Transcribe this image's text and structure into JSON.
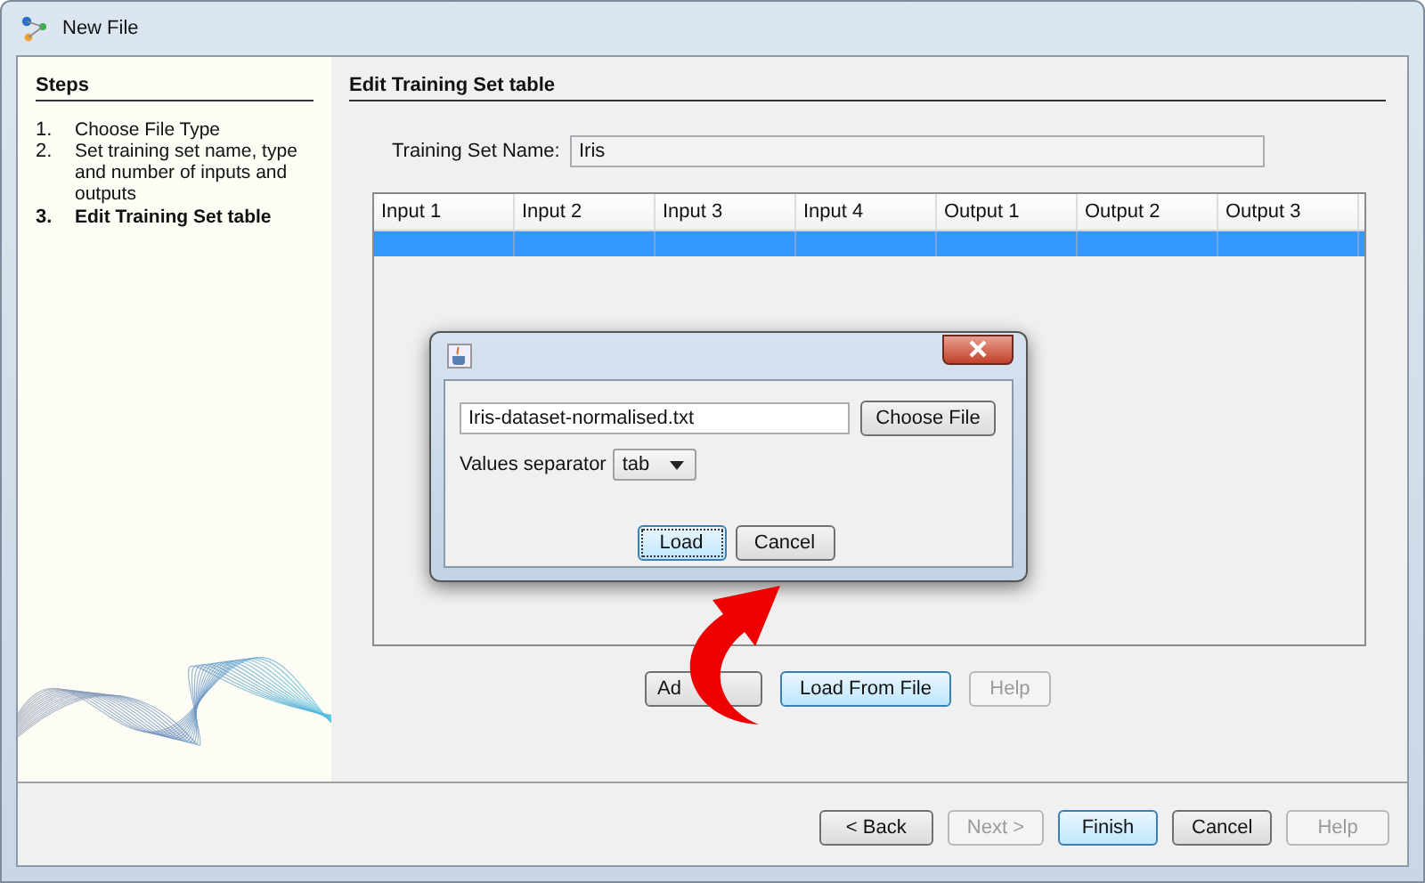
{
  "window": {
    "title": "New File"
  },
  "steps": {
    "title": "Steps",
    "items": [
      {
        "number": "1.",
        "text": "Choose File Type",
        "selected": false
      },
      {
        "number": "2.",
        "text": "Set training set name, type and number of inputs and outputs",
        "selected": false
      },
      {
        "number": "3.",
        "text": "Edit Training Set table",
        "selected": true
      }
    ]
  },
  "panel": {
    "title": "Edit Training Set table",
    "name_label": "Training Set Name:",
    "name_value": "Iris"
  },
  "table": {
    "columns": [
      "Input 1",
      "Input 2",
      "Input 3",
      "Input 4",
      "Output 1",
      "Output 2",
      "Output 3"
    ],
    "rows": [
      {
        "selected": true
      }
    ]
  },
  "table_buttons": [
    {
      "label": "Ad",
      "disabled": false,
      "highlighted": false
    },
    {
      "label": "Load From File",
      "disabled": false,
      "highlighted": true
    },
    {
      "label": "Help",
      "disabled": true,
      "highlighted": false
    }
  ],
  "dialog": {
    "file_value": "Iris-dataset-normalised.txt",
    "choose_button": "Choose File",
    "separator_label": "Values separator",
    "separator_value": "tab",
    "buttons": [
      {
        "label": "Load",
        "highlighted": true
      },
      {
        "label": "Cancel",
        "highlighted": false
      }
    ]
  },
  "buttons": [
    {
      "label": "< Back",
      "disabled": false,
      "highlighted": false
    },
    {
      "label": "Next >",
      "disabled": true,
      "highlighted": false
    },
    {
      "label": "Finish",
      "disabled": false,
      "highlighted": true
    },
    {
      "label": "Cancel",
      "disabled": false,
      "highlighted": false
    },
    {
      "label": "Help",
      "disabled": true,
      "highlighted": false
    }
  ]
}
